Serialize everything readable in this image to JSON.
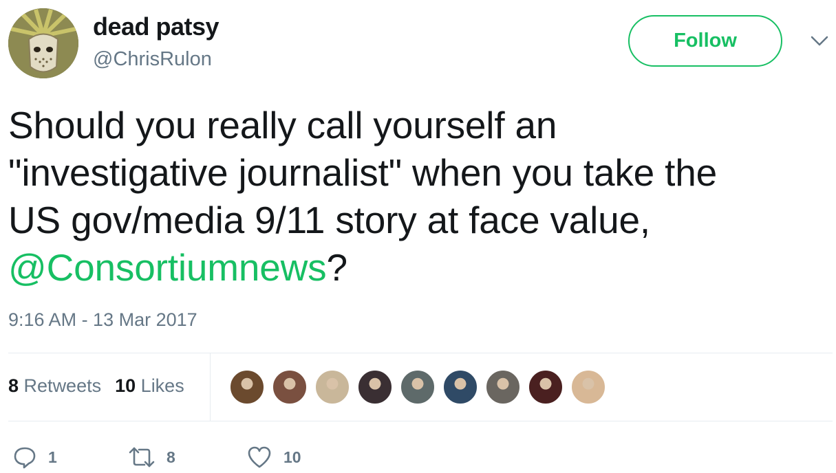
{
  "user": {
    "display_name": "dead patsy",
    "handle": "@ChrisRulon",
    "avatar_icon": "statue-of-liberty-mask-avatar"
  },
  "follow_button": {
    "label": "Follow"
  },
  "menu_icon": "chevron-down-icon",
  "tweet": {
    "text_line1": "Should you really call yourself an",
    "text_line2": "\"investigative journalist\" when you take the",
    "text_line3": "US gov/media 9/11 story at face value,",
    "mention": "@Consortiumnews",
    "text_end": "?"
  },
  "timestamp": "9:16 AM - 13 Mar 2017",
  "stats": {
    "retweets_count": "8",
    "retweets_label": "Retweets",
    "likes_count": "10",
    "likes_label": "Likes"
  },
  "likers": [
    {
      "name": "liker-avatar-1",
      "color": "#6b4a2e"
    },
    {
      "name": "liker-avatar-2",
      "color": "#7a5040"
    },
    {
      "name": "liker-avatar-3",
      "color": "#c9b79a"
    },
    {
      "name": "liker-avatar-4",
      "color": "#3a2f33"
    },
    {
      "name": "liker-avatar-5",
      "color": "#5e6a6a"
    },
    {
      "name": "liker-avatar-6",
      "color": "#2f4a66"
    },
    {
      "name": "liker-avatar-7",
      "color": "#6a6660"
    },
    {
      "name": "liker-avatar-8",
      "color": "#4a2020"
    },
    {
      "name": "liker-avatar-9",
      "color": "#d8b896"
    }
  ],
  "actions": {
    "reply_count": "1",
    "retweet_count": "8",
    "like_count": "10"
  },
  "colors": {
    "accent": "#17bf63",
    "secondary_text": "#657786",
    "primary_text": "#14171a"
  }
}
